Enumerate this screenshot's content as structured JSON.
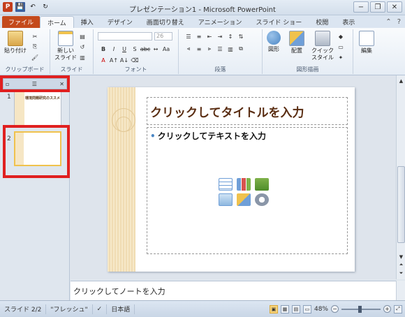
{
  "window": {
    "title": "プレゼンテーション1 - Microsoft PowerPoint"
  },
  "qat": {
    "app_icon": "P",
    "save_icon": "💾",
    "undo_icon": "↶",
    "redo_icon": "↻"
  },
  "window_controls": {
    "minimize": "−",
    "restore": "❐",
    "close": "✕"
  },
  "tabs": [
    {
      "label": "ファイル"
    },
    {
      "label": "ホーム"
    },
    {
      "label": "挿入"
    },
    {
      "label": "デザイン"
    },
    {
      "label": "画面切り替え"
    },
    {
      "label": "アニメーション"
    },
    {
      "label": "スライド ショー"
    },
    {
      "label": "校閲"
    },
    {
      "label": "表示"
    }
  ],
  "ribbon": {
    "groups": {
      "clipboard": {
        "label": "クリップボード",
        "paste": "貼り付け"
      },
      "slides": {
        "label": "スライド",
        "new_slide_line1": "新しい",
        "new_slide_line2": "スライド"
      },
      "font": {
        "label": "フォント",
        "size": "26"
      },
      "paragraph": {
        "label": "段落"
      },
      "drawing": {
        "label": "図形描画",
        "shapes": "図形",
        "arrange": "配置",
        "quick_styles_line1": "クイック",
        "quick_styles_line2": "スタイル"
      },
      "editing": {
        "label": "編集",
        "edit": "編集"
      }
    }
  },
  "left_panel": {
    "slide1_number": "1",
    "slide1_title": "環境問題研究のススメ",
    "slide2_number": "2"
  },
  "slide": {
    "title_placeholder": "クリックしてタイトルを入力",
    "body_placeholder": "クリックしてテキストを入力"
  },
  "notes": {
    "placeholder": "クリックしてノートを入力"
  },
  "statusbar": {
    "slide_info": "スライド 2/2",
    "theme": "\"フレッシュ\"",
    "language": "日本語",
    "zoom": "48%"
  },
  "colors": {
    "file_tab": "#c44a1c",
    "title_text": "#5a2d12",
    "highlight_red": "#e02020",
    "selected_thumb": "#f0c24d"
  }
}
